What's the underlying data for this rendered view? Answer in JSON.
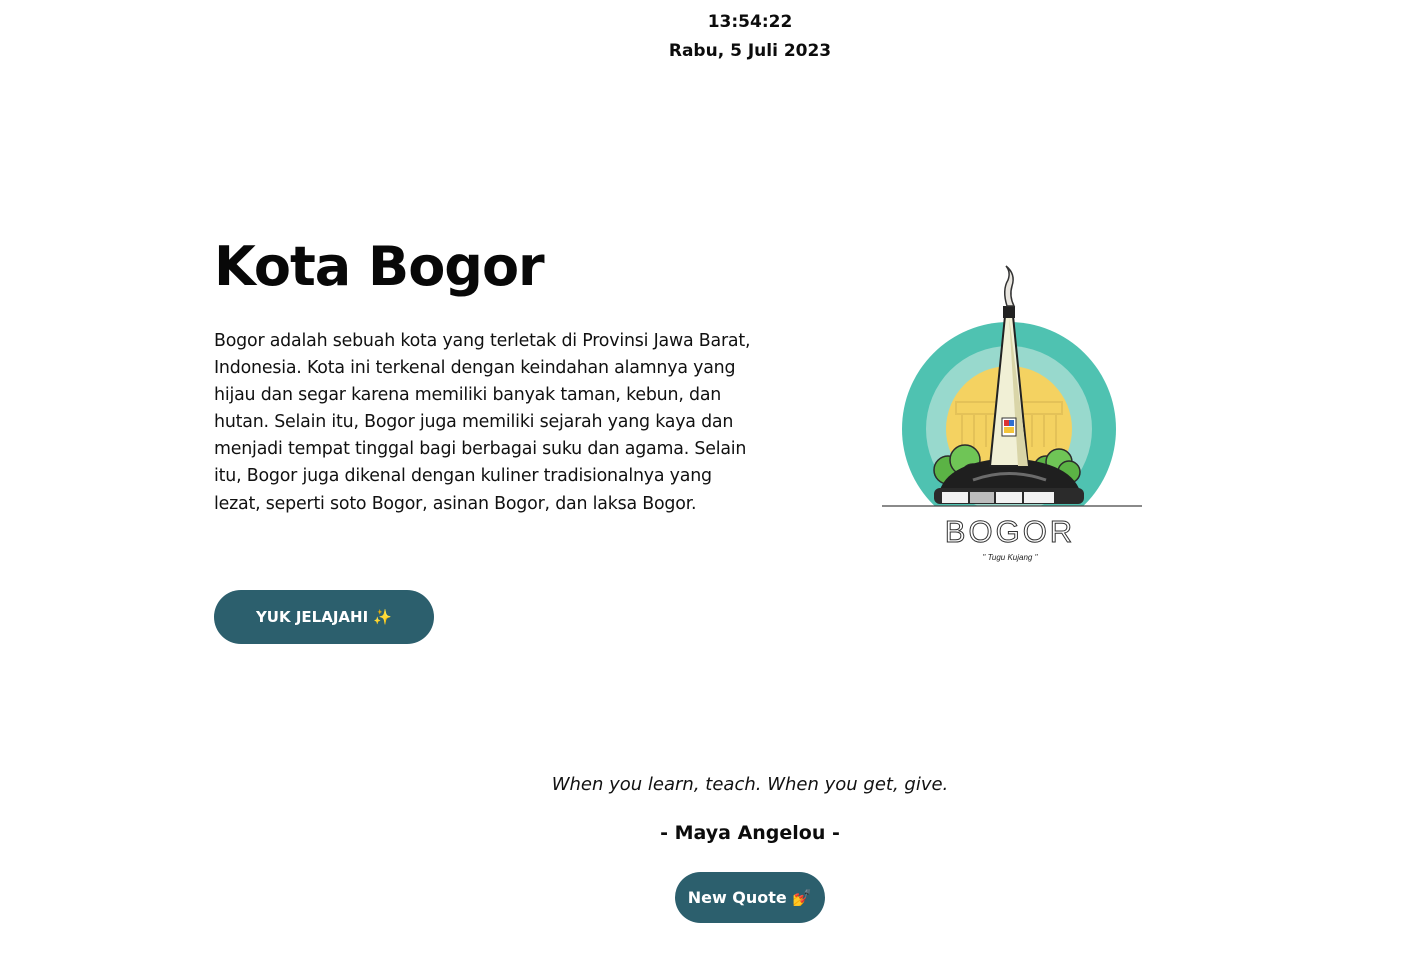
{
  "clock": {
    "time": "13:54:22",
    "date": "Rabu, 5 Juli 2023"
  },
  "hero": {
    "title": "Kota Bogor",
    "description": "Bogor adalah sebuah kota yang terletak di Provinsi Jawa Barat, Indonesia. Kota ini terkenal dengan keindahan alamnya yang hijau dan segar karena memiliki banyak taman, kebun, dan hutan. Selain itu, Bogor juga memiliki sejarah yang kaya dan menjadi tempat tinggal bagi berbagai suku dan agama. Selain itu, Bogor juga dikenal dengan kuliner tradisionalnya yang lezat, seperti soto Bogor, asinan Bogor, dan laksa Bogor.",
    "cta_label": "YUK JELAJAHI ✨"
  },
  "illustration": {
    "logo_text": "BOGOR",
    "caption": "\" Tugu Kujang \""
  },
  "quote": {
    "text": "When you learn, teach. When you get, give.",
    "author": "- Maya Angelou -",
    "button_label": "New Quote 💅"
  },
  "colors": {
    "button_bg": "#2c5f6d",
    "teal_outer": "#4fc2b1",
    "teal_inner": "#98d9cd",
    "sun": "#f4d261",
    "tree": "#5bb345"
  }
}
